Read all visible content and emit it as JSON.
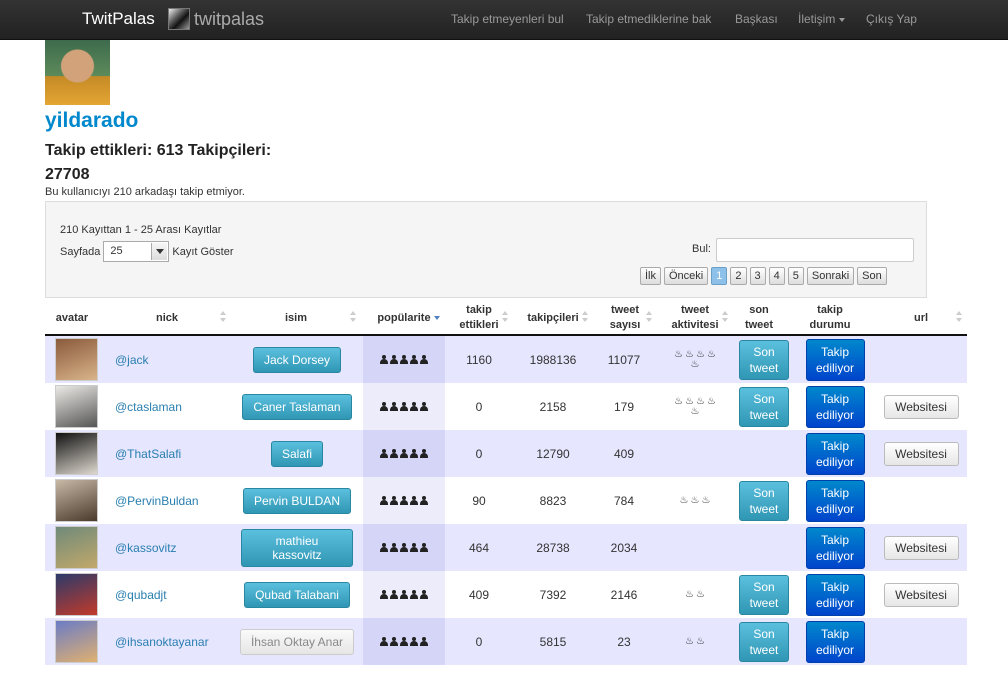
{
  "navbar": {
    "brand": "TwitPalas",
    "logo_text": "twitpalas",
    "links": [
      "Takip etmeyenleri bul",
      "Takip etmediklerine bak",
      "Başkası",
      "İletişim",
      "Çıkış Yap"
    ]
  },
  "profile": {
    "username": "yildarado",
    "stats_line1": "Takip ettikleri: 613 Takipçileri:",
    "stats_line2": "27708",
    "notice": "Bu kullanıcıyı 210 arkadaşı takip etmiyor."
  },
  "controls": {
    "info": "210 Kayıttan 1 - 25 Arası Kayıtlar",
    "length_before": "Sayfada",
    "length_value": "25",
    "length_after": "Kayıt Göster",
    "search_label": "Bul:",
    "pager": [
      "İlk",
      "Önceki",
      "1",
      "2",
      "3",
      "4",
      "5",
      "Sonraki",
      "Son"
    ]
  },
  "table": {
    "headers": [
      "avatar",
      "nick",
      "isim",
      "popülarite",
      "takip ettikleri",
      "takipçileri",
      "tweet sayısı",
      "tweet aktivitesi",
      "son tweet",
      "takip durumu",
      "url"
    ],
    "son_label": "Son tweet",
    "takip_label": "Takip ediliyor",
    "web_label": "Websitesi",
    "rows": [
      {
        "nick": "@jack",
        "name": "Jack Dorsey",
        "takip": "1160",
        "takipci": "1988136",
        "tweet": "11077",
        "flames": 5,
        "son": true,
        "web": false,
        "avatar": [
          "#8a5a3c",
          "#d9b48a"
        ]
      },
      {
        "nick": "@ctaslaman",
        "name": "Caner Taslaman",
        "takip": "0",
        "takipci": "2158",
        "tweet": "179",
        "flames": 5,
        "son": true,
        "web": true,
        "avatar": [
          "#eceae6",
          "#555555"
        ]
      },
      {
        "nick": "@ThatSalafi",
        "name": "Salafi",
        "takip": "0",
        "takipci": "12790",
        "tweet": "409",
        "flames": 0,
        "son": false,
        "web": true,
        "avatar": [
          "#111111",
          "#ded8cf"
        ]
      },
      {
        "nick": "@PervinBuldan",
        "name": "Pervin BULDAN",
        "takip": "90",
        "takipci": "8823",
        "tweet": "784",
        "flames": 3,
        "son": true,
        "web": false,
        "avatar": [
          "#c7b9a6",
          "#4a3a2c"
        ]
      },
      {
        "nick": "@kassovitz",
        "name": "mathieu kassovitz",
        "takip": "464",
        "takipci": "28738",
        "tweet": "2034",
        "flames": 0,
        "son": false,
        "web": true,
        "avatar": [
          "#6f8a7a",
          "#c2a86a"
        ]
      },
      {
        "nick": "@qubadjt",
        "name": "Qubad Talabani",
        "takip": "409",
        "takipci": "7392",
        "tweet": "2146",
        "flames": 2,
        "son": true,
        "web": true,
        "avatar": [
          "#2b3a6a",
          "#c33a2a"
        ]
      },
      {
        "nick": "@ihsanoktayanar",
        "name": "İhsan Oktay Anar",
        "takip": "0",
        "takipci": "5815",
        "tweet": "23",
        "flames": 2,
        "son": true,
        "web": false,
        "avatar": [
          "#6b7cc6",
          "#e0b070"
        ],
        "grey": true
      }
    ]
  }
}
